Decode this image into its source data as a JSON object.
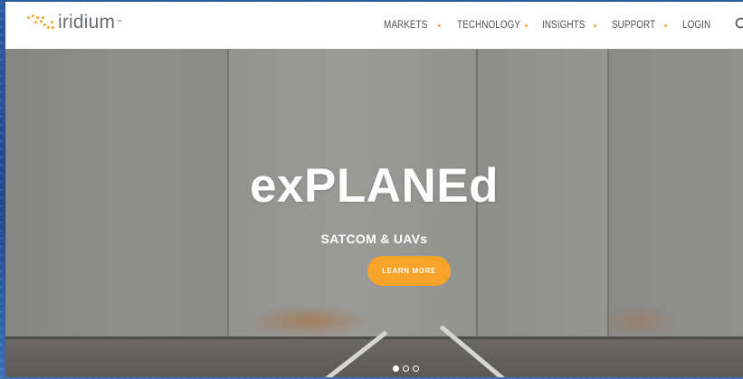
{
  "logo": {
    "text": "iridium",
    "tm": "™"
  },
  "nav": {
    "items": [
      {
        "label": "MARKETS"
      },
      {
        "label": "TECHNOLOGY"
      },
      {
        "label": "INSIGHTS"
      },
      {
        "label": "SUPPORT"
      },
      {
        "label": "LOGIN"
      }
    ],
    "separator_color": "#f5a623"
  },
  "search": {
    "icon": "search-icon"
  },
  "hero": {
    "title": "exPLANEd",
    "subtitle": "SATCOM & UAVs",
    "cta_label": "LEARN MORE",
    "cta_color": "#f7a229"
  },
  "carousel": {
    "slide_count": 3,
    "active_index": 0
  },
  "colors": {
    "brand_orange": "#f5a623",
    "nav_text": "#4d4f52",
    "frame_blue": "#1f4f92"
  }
}
